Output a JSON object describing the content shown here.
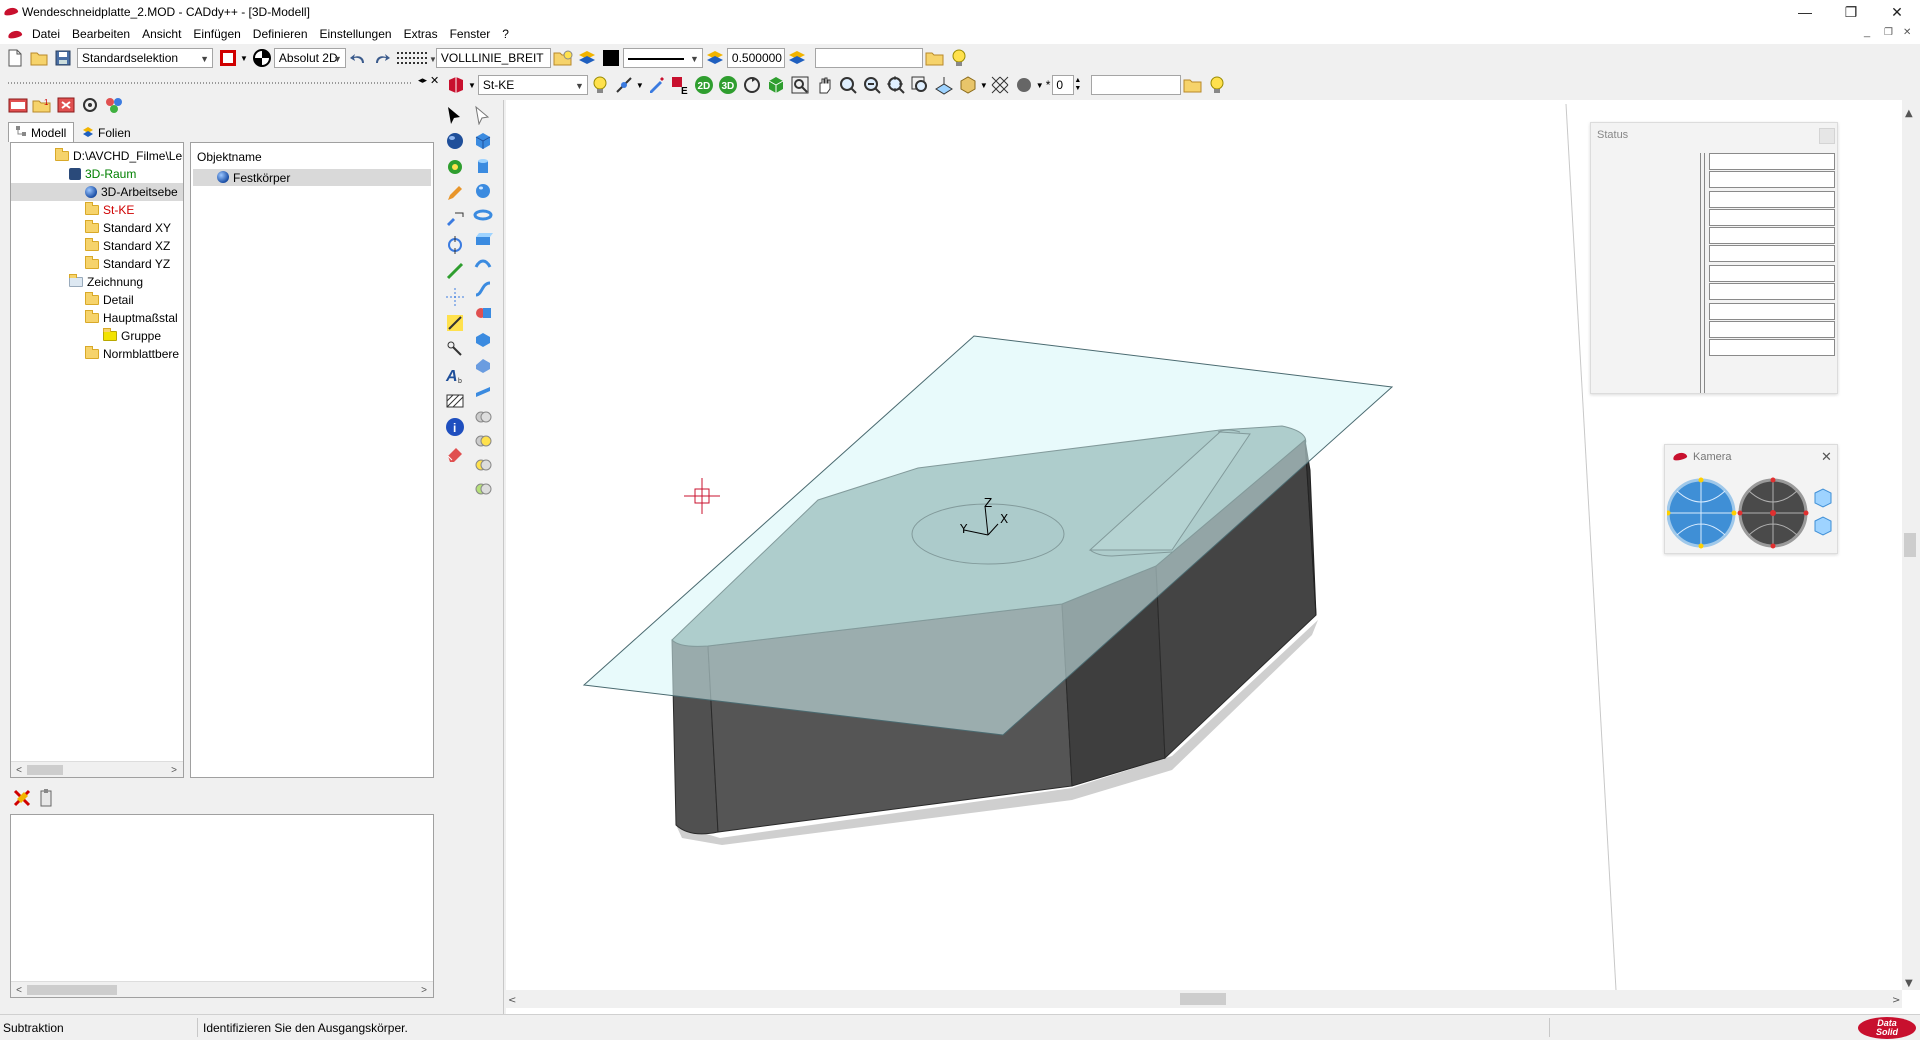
{
  "window": {
    "title": "Wendeschneidplatte_2.MOD  -  CADdy++ - [3D-Modell]",
    "minimize": "—",
    "restore": "❐",
    "close": "✕",
    "mdi_minimize": "_",
    "mdi_restore": "❐",
    "mdi_close": "✕"
  },
  "menu": [
    "Datei",
    "Bearbeiten",
    "Ansicht",
    "Einfügen",
    "Definieren",
    "Einstellungen",
    "Extras",
    "Fenster",
    "?"
  ],
  "toolbar1": {
    "selection_mode": "Standardselektion",
    "coord_mode": "Absolut 2D",
    "linetype": "VOLLLINIE_BREIT",
    "line_width": "0.500000",
    "search_value": ""
  },
  "toolbar2": {
    "layer": "St-KE",
    "btn_2d": "2D",
    "btn_3d": "3D",
    "spin_value": "0",
    "search_value": ""
  },
  "tabs": [
    "Modell",
    "Folien"
  ],
  "tree": [
    {
      "label": "D:\\AVCHD_Filme\\Lern",
      "icon": "folder-icon",
      "color": "#000000"
    },
    {
      "label": "3D-Raum",
      "icon": "cube-icon",
      "color": "#008000"
    },
    {
      "label": "3D-Arbeitsebe",
      "icon": "sphere-icon",
      "color": "#000000"
    },
    {
      "label": "St-KE",
      "icon": "folder-icon",
      "color": "#d00000"
    },
    {
      "label": "Standard XY",
      "icon": "folder-icon",
      "color": "#000000"
    },
    {
      "label": "Standard XZ",
      "icon": "folder-icon",
      "color": "#000000"
    },
    {
      "label": "Standard YZ",
      "icon": "folder-icon",
      "color": "#000000"
    },
    {
      "label": "Zeichnung",
      "icon": "folder-open-icon",
      "color": "#000000"
    },
    {
      "label": "Detail",
      "icon": "folder-icon",
      "color": "#000000"
    },
    {
      "label": "Hauptmaßstal",
      "icon": "folder-icon",
      "color": "#000000"
    },
    {
      "label": "Gruppe",
      "icon": "group-icon",
      "color": "#000000"
    },
    {
      "label": "Normblattbere",
      "icon": "folder-icon",
      "color": "#000000"
    }
  ],
  "objects": {
    "header": "Objektname",
    "items": [
      "Festkörper"
    ]
  },
  "status_panel": {
    "title": "Status"
  },
  "camera_panel": {
    "title": "Kamera",
    "close": "✕"
  },
  "axis_labels": {
    "z": "Z",
    "y": "Y",
    "x": "X"
  },
  "statusbar": {
    "command": "Subtraktion",
    "prompt": "Identifizieren Sie den Ausgangskörper.",
    "brand_line1": "Data",
    "brand_line2": "Solid"
  },
  "colors": {
    "accent_red": "#c8102e",
    "tree_green": "#008000",
    "tree_red": "#d00000",
    "plane_fill": "#d6f5f7",
    "body_top": "#7f9c98",
    "body_side": "#5a5a5a"
  }
}
